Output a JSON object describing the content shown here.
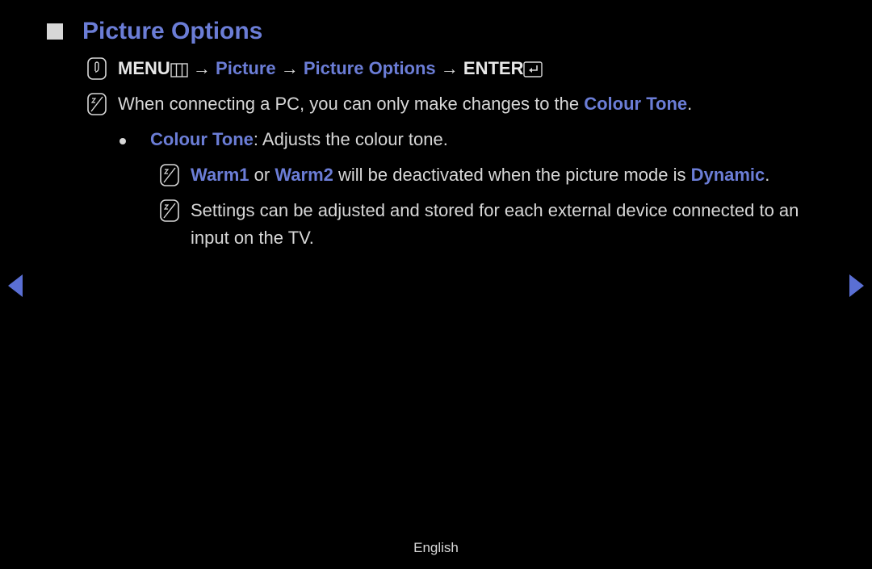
{
  "title": "Picture Options",
  "breadcrumb": {
    "menu": "MENU",
    "arrow": "→",
    "picture": "Picture",
    "picture_options": "Picture Options",
    "enter": "ENTER"
  },
  "note1": {
    "prefix": "When connecting a PC, you can only make changes to the ",
    "highlight": "Colour Tone",
    "suffix": "."
  },
  "bullet": {
    "label": "Colour Tone",
    "desc": ": Adjusts the colour tone."
  },
  "subnote1": {
    "w1": "Warm1",
    "or": " or ",
    "w2": "Warm2",
    "mid": " will be deactivated when the picture mode is ",
    "dynamic": "Dynamic",
    "end": "."
  },
  "subnote2": "Settings can be adjusted and stored for each external device connected to an input on the TV.",
  "footer": "English"
}
